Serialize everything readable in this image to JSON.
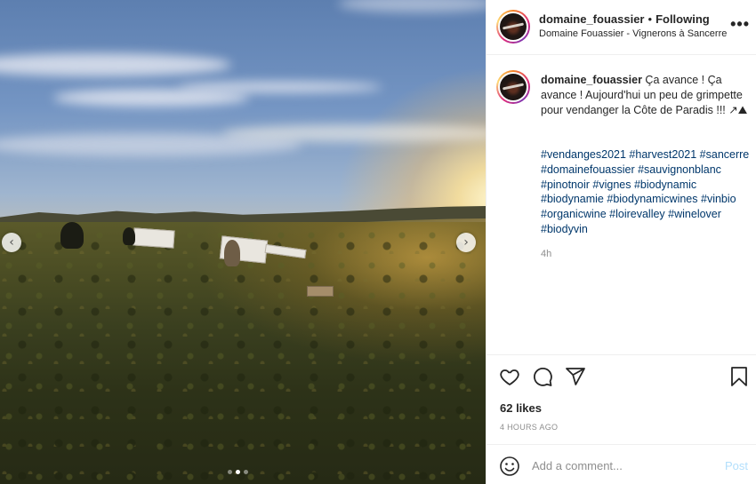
{
  "post": {
    "username": "domaine_fouassier",
    "separator": "•",
    "follow_status": "Following",
    "location": "Domaine Fouassier - Vignerons à Sancerre",
    "more_glyph": "•••",
    "caption": "Ça avance ! Ça avance ! Aujourd'hui un peu de grimpette pour vendanger la Côte de Paradis !!! ↗⛰",
    "hashtags": [
      "#vendanges2021",
      "#harvest2021",
      "#sancerre",
      "#domainefouassier",
      "#sauvignonblanc",
      "#pinotnoir",
      "#vignes",
      "#biodynamic",
      "#biodynamie",
      "#biodynamicwines",
      "#vinbio",
      "#organicwine",
      "#loirevalley",
      "#winelover",
      "#biodyvin"
    ],
    "caption_age": "4h",
    "likes": "62 likes",
    "posted_ago": "4 HOURS AGO"
  },
  "carousel": {
    "prev_glyph": "‹",
    "next_glyph": "›",
    "slide_count": 3,
    "active_slide": 2
  },
  "comment": {
    "placeholder": "Add a comment...",
    "post_label": "Post"
  },
  "icons": {
    "like": "heart-icon",
    "comment": "comment-bubble-icon",
    "share": "paper-plane-icon",
    "save": "bookmark-icon",
    "emoji": "smiley-icon"
  },
  "colors": {
    "hashtag": "#00376b",
    "post_disabled": "#b2dffc",
    "muted": "#8e8e8e"
  }
}
